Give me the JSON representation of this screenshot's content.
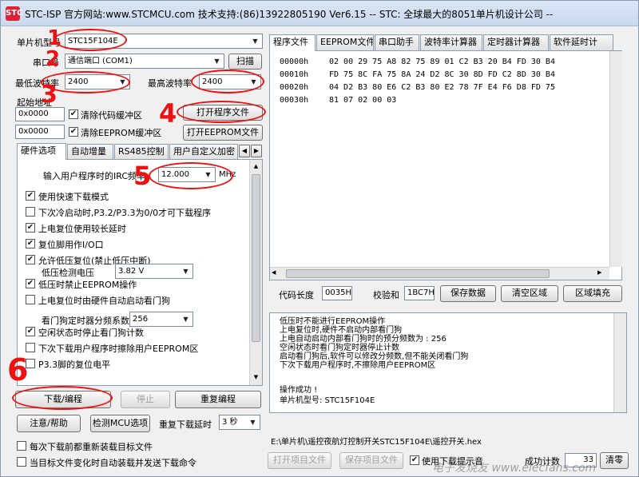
{
  "title": "STC-ISP   官方网站:www.STCMCU.com   技术支持:(86)13922805190  Ver6.15 -- STC: 全球最大的8051单片机设计公司 --",
  "app_icon": "STC",
  "left": {
    "mcu_label": "单片机型号",
    "mcu_value": "STC15F104E",
    "port_label": "串口号",
    "port_value": "通信端口 (COM1)",
    "scan_button": "扫描",
    "min_baud_label": "最低波特率",
    "min_baud_value": "2400",
    "max_baud_label": "最高波特率",
    "max_baud_value": "2400",
    "start_addr_label": "起始地址",
    "addr1": "0x0000",
    "clear_code": "清除代码缓冲区",
    "open_prog": "打开程序文件",
    "addr2": "0x0000",
    "clear_eeprom": "清除EEPROM缓冲区",
    "open_eeprom": "打开EEPROM文件",
    "tabs": [
      "硬件选项",
      "自动增量",
      "RS485控制",
      "用户自定义加密"
    ],
    "irc_label": "输入用户程序时的IRC频率",
    "irc_value": "12.000",
    "irc_unit": "MHz",
    "options": [
      {
        "label": "使用快速下载模式",
        "checked": true
      },
      {
        "label": "下次冷启动时,P3.2/P3.3为0/0才可下载程序",
        "checked": false
      },
      {
        "label": "上电复位使用较长延时",
        "checked": true
      },
      {
        "label": "复位脚用作I/O口",
        "checked": true
      },
      {
        "label": "允许低压复位(禁止低压中断)",
        "checked": true
      }
    ],
    "lvd_label": "低压检测电压",
    "lvd_value": "3.82 V",
    "options2": [
      {
        "label": "低压时禁止EEPROM操作",
        "checked": true
      },
      {
        "label": "上电复位时由硬件自动启动看门狗",
        "checked": false
      }
    ],
    "wdt_label": "看门狗定时器分频系数",
    "wdt_value": "256",
    "options3": [
      {
        "label": "空闲状态时停止看门狗计数",
        "checked": true
      },
      {
        "label": "下次下载用户程序时擦除用户EEPROM区",
        "checked": false
      },
      {
        "label": "P3.3脚的复位电平",
        "checked": false
      }
    ],
    "download_btn": "下载/编程",
    "stop_btn": "停止",
    "redownload_btn": "重复编程",
    "help_btn": "注意/帮助",
    "detect_btn": "检测MCU选项",
    "retry_label": "重复下载延时",
    "retry_value": "3 秒",
    "reload_each": "每次下载前都重新装载目标文件",
    "auto_reload": "当目标文件变化时自动装载并发送下载命令"
  },
  "right": {
    "tabs": [
      "程序文件",
      "EEPROM文件",
      "串口助手",
      "波特率计算器",
      "定时器计算器",
      "软件延时计"
    ],
    "hex_rows": [
      {
        "addr": "00000h",
        "bytes": "02 00 29 75 A8 82 75 89 01 C2 B3 20 B4 FD 30 B4"
      },
      {
        "addr": "00010h",
        "bytes": "FD 75 8C FA 75 8A 24 D2 8C 30 8D FD C2 8D 30 B4"
      },
      {
        "addr": "00020h",
        "bytes": "04 D2 B3 80 E6 C2 B3 80 E2 78 7F E4 F6 D8 FD 75"
      },
      {
        "addr": "00030h",
        "bytes": "81 07 02 00 03"
      }
    ],
    "code_len_label": "代码长度",
    "code_len_value": "0035H",
    "checksum_label": "校验和",
    "checksum_value": "1BC7H",
    "save_data": "保存数据",
    "clear_area": "清空区域",
    "fill_area": "区域填充",
    "log_lines": [
      "低压时不能进行EEPROM操作",
      "上电复位时,硬件不启动内部看门狗",
      "上电自动启动内部看门狗时的预分频数为 : 256",
      "空闲状态时看门狗定时器停止计数",
      "启动看门狗后,软件可以修改分频数,但不能关闭看门狗",
      "下次下载用户程序时,不擦除用户EEPROM区"
    ],
    "success": "操作成功 !",
    "mcu_line": "单片机型号: STC15F104E",
    "file_path": "E:\\单片机\\遥控夜航灯控制开关STC15F104E\\遥控开关.hex",
    "open_proj": "打开项目文件",
    "save_proj": "保存项目文件",
    "beep_label": "使用下载提示音",
    "success_count_label": "成功计数",
    "success_count_value": "33",
    "clear_btn": "清零"
  },
  "annotations": [
    "1",
    "2",
    "3",
    "4",
    "5",
    "6"
  ],
  "watermark": "电子发烧友 www.elecfans.com",
  "colors": {
    "annotation": "#e11111",
    "titlebar": "#c9d9ee"
  }
}
